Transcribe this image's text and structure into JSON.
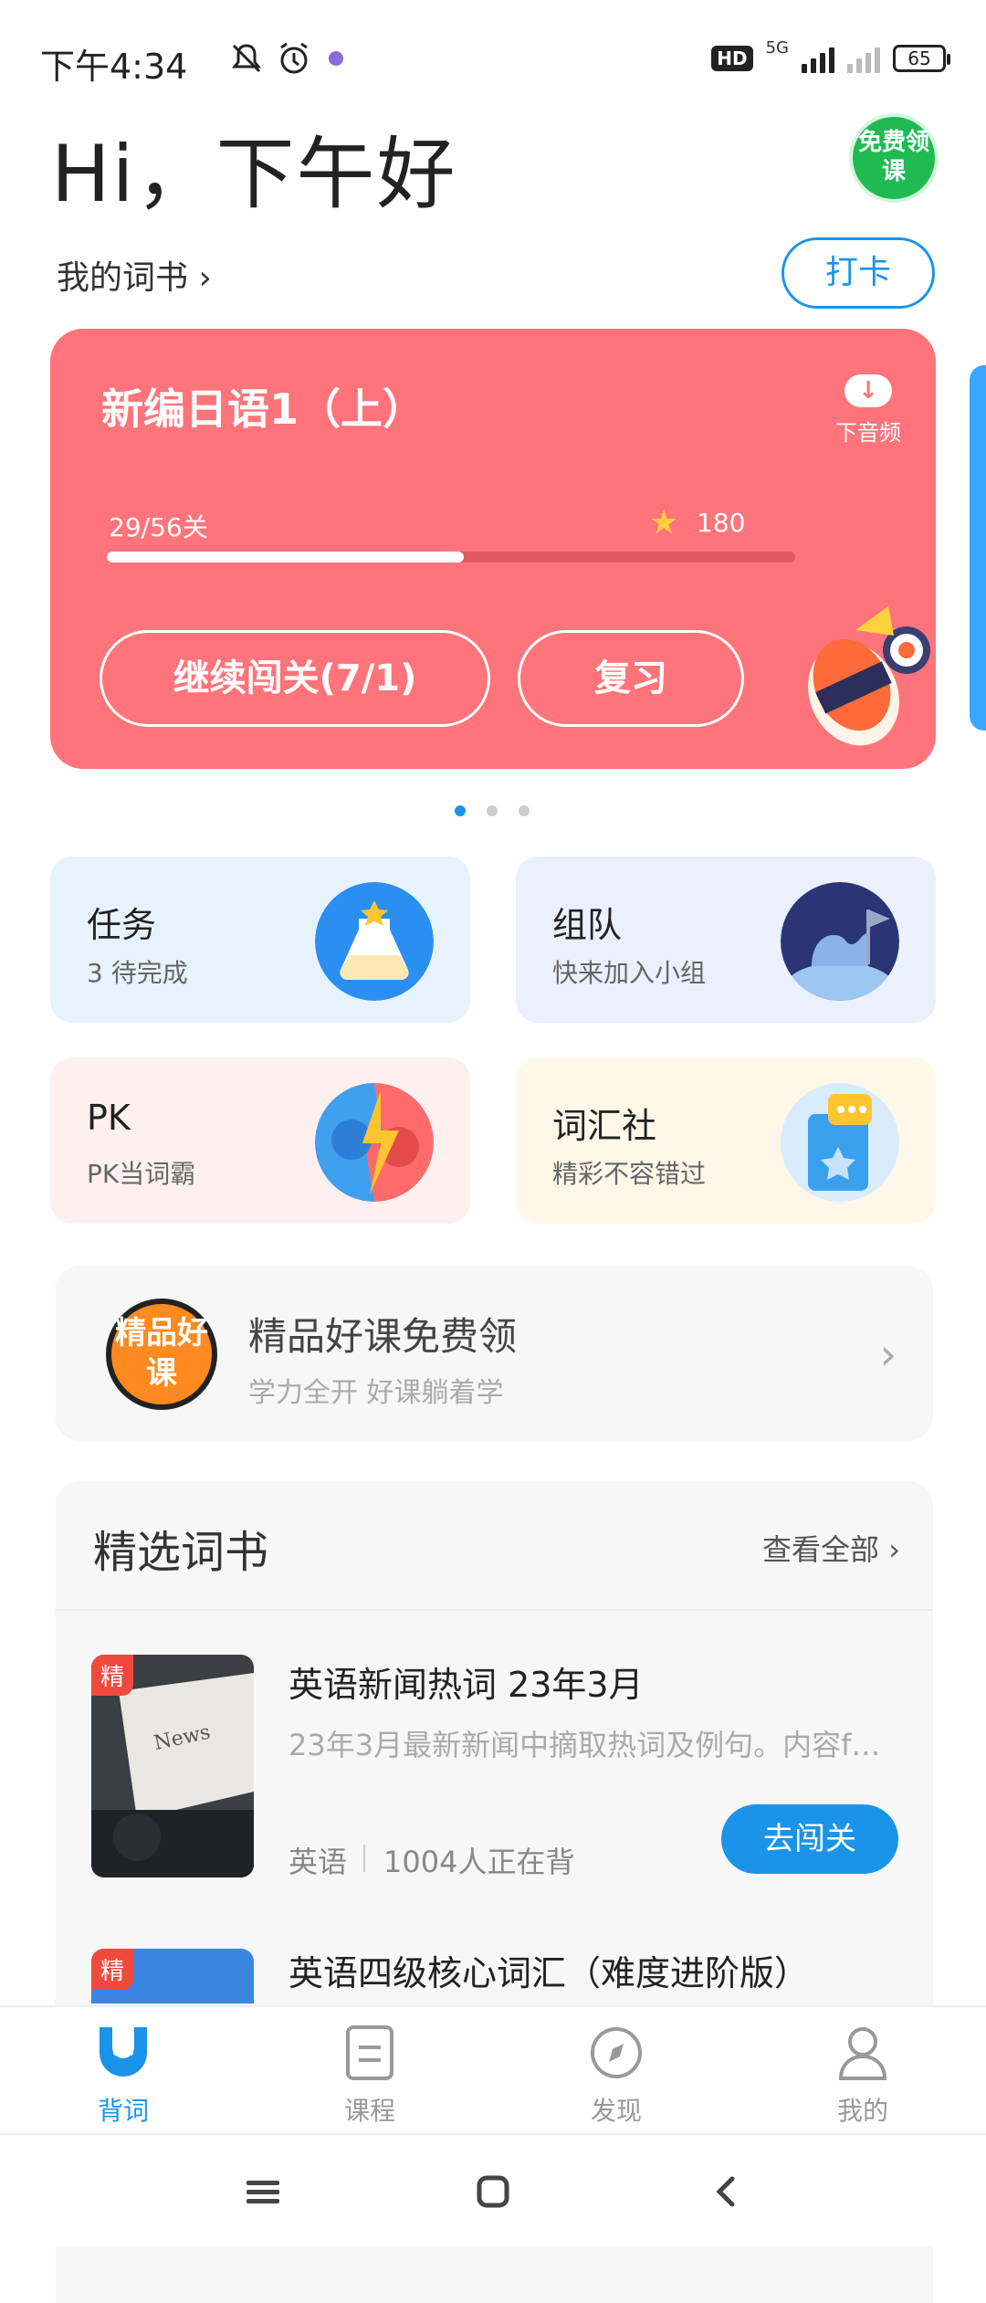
{
  "status": {
    "time": "下午4:34",
    "network": "5G",
    "hd": "HD",
    "battery": "65"
  },
  "header": {
    "greeting": "Hi，下午好",
    "badge": "免费领课",
    "my_books": "我的词书",
    "checkin": "打卡"
  },
  "card": {
    "title": "新编日语1（上）",
    "download": "下音频",
    "progress_text": "29/56关",
    "progress": 0.518,
    "stars": "180",
    "continue": "继续闯关(7/1)",
    "review": "复习"
  },
  "tiles": [
    {
      "title": "任务",
      "sub": "3 待完成",
      "icon": "flask-icon",
      "bg": "#e6f3fe"
    },
    {
      "title": "组队",
      "sub": "快来加入小组",
      "icon": "camel-moon-icon",
      "bg": "#eaf0fe"
    },
    {
      "title": "PK",
      "sub": "PK当词霸",
      "icon": "boxing-icon",
      "bg": "#fff0f0"
    },
    {
      "title": "词汇社",
      "sub": "精彩不容错过",
      "icon": "book-chat-icon",
      "bg": "#fff7e8"
    }
  ],
  "promo": {
    "logo": "精品好课",
    "title": "精品好课免费领",
    "sub": "学力全开 好课躺着学"
  },
  "featured": {
    "title": "精选词书",
    "more": "查看全部",
    "books": [
      {
        "tag": "精",
        "title": "英语新闻热词 23年3月",
        "desc": "23年3月最新新闻中摘取热词及例句。内容f…",
        "lang": "英语",
        "count": "1004人正在背",
        "action": "去闯关"
      },
      {
        "tag": "精",
        "title": "英语四级核心词汇（难度进阶版）"
      }
    ]
  },
  "nav": [
    {
      "label": "背词",
      "active": true
    },
    {
      "label": "课程",
      "active": false
    },
    {
      "label": "发现",
      "active": false
    },
    {
      "label": "我的",
      "active": false
    }
  ],
  "colors": {
    "accent": "#1a94e8",
    "card": "#ff747a",
    "promo_bg": "#f7f7f7"
  }
}
